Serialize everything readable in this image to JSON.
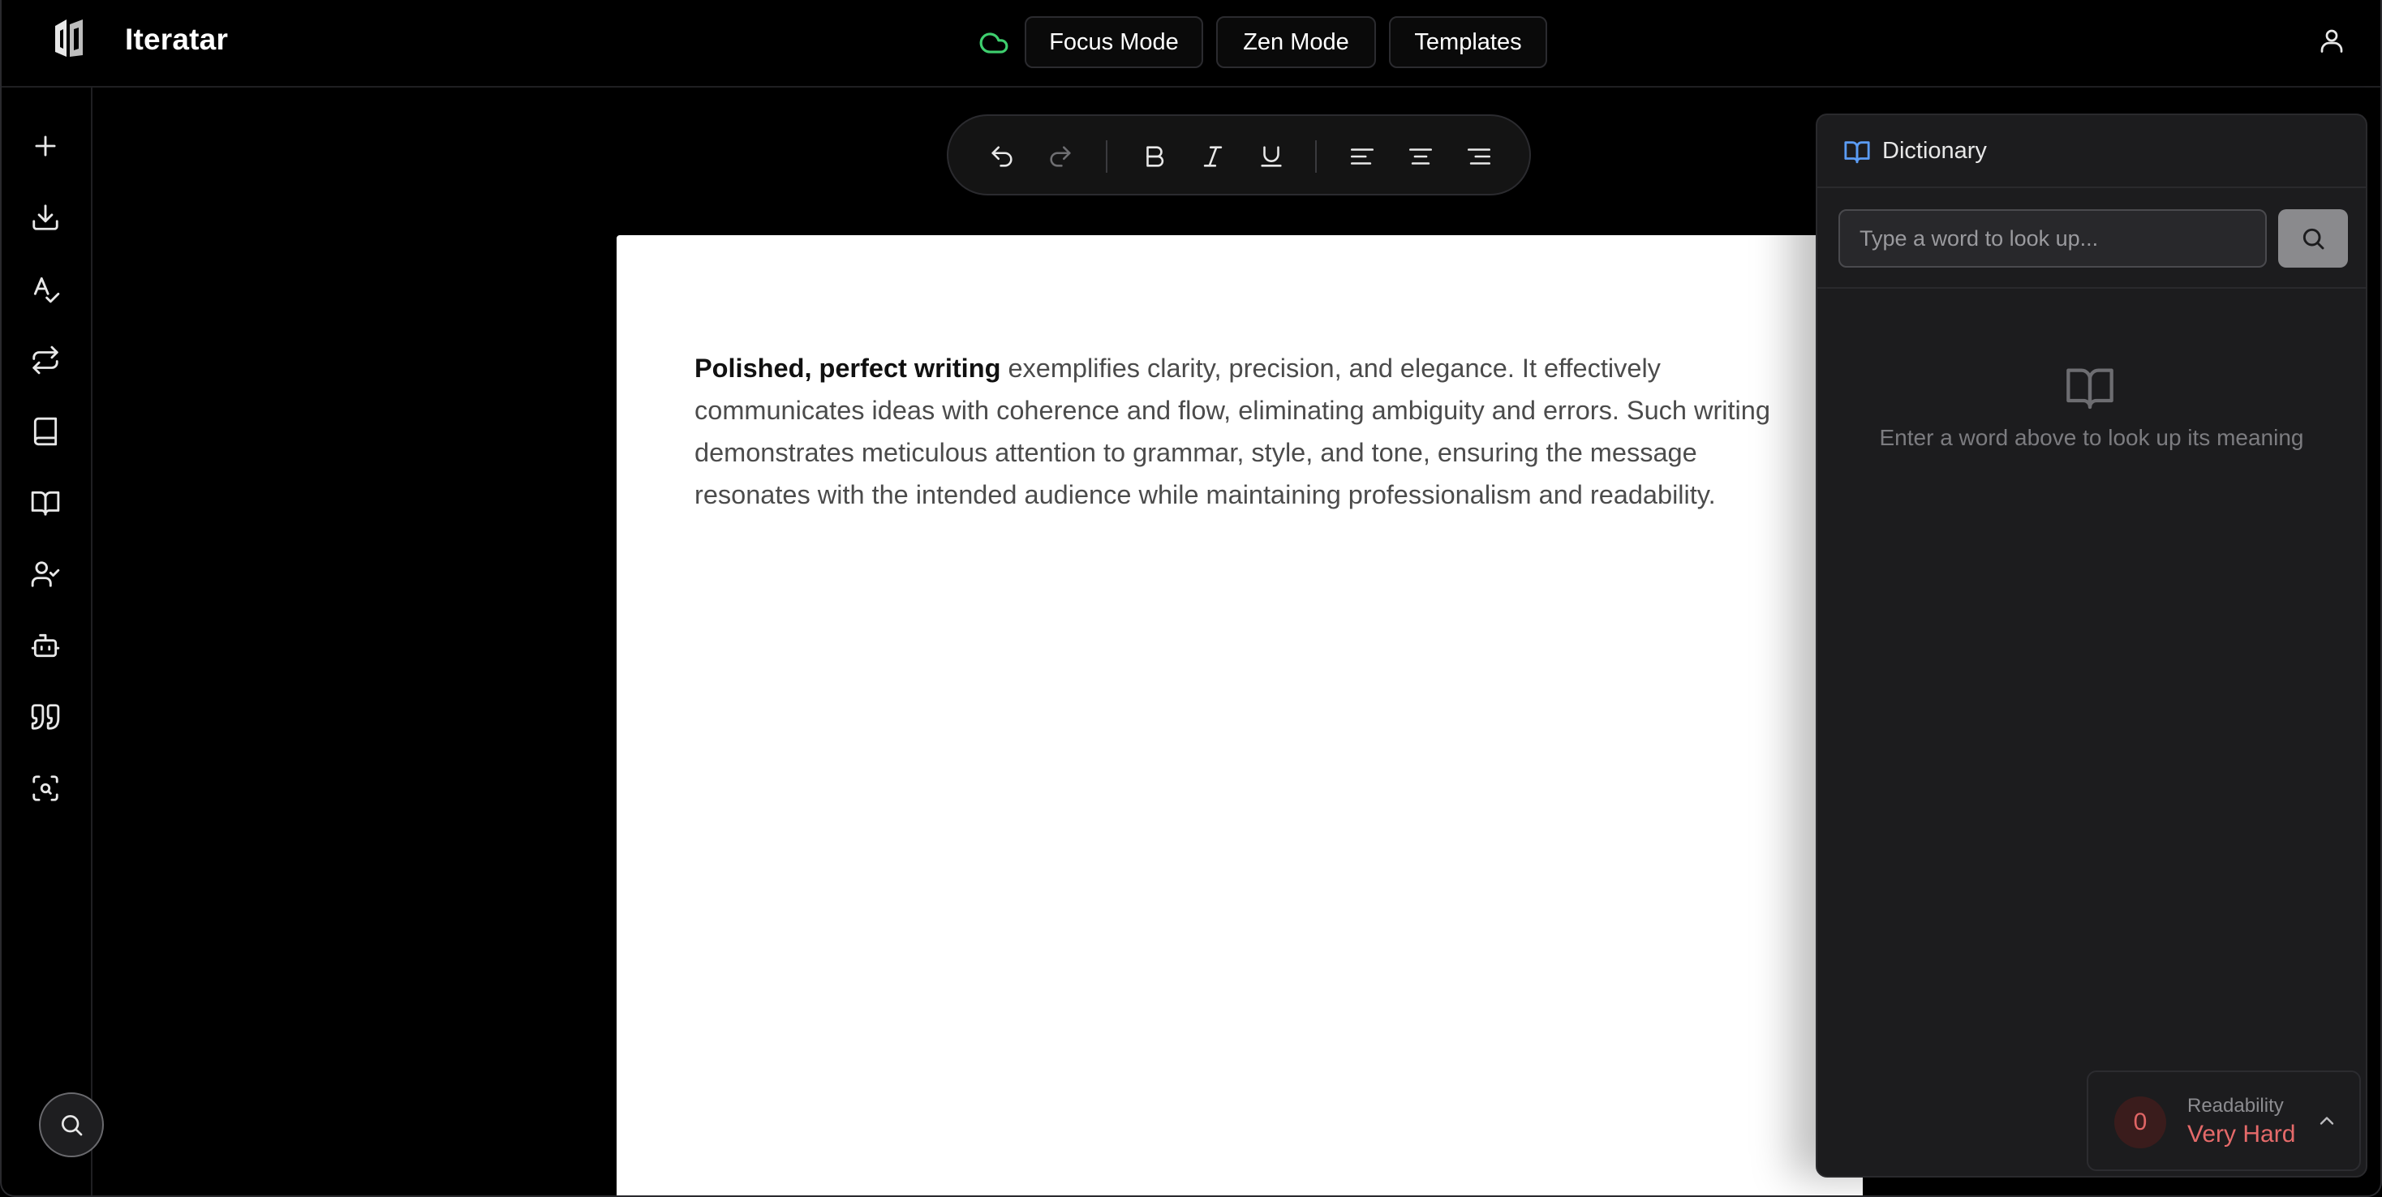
{
  "app": {
    "name": "Iteratar"
  },
  "topbar": {
    "focus_mode_label": "Focus Mode",
    "zen_mode_label": "Zen Mode",
    "templates_label": "Templates",
    "sync_status_color": "#3ecf6e"
  },
  "sidebar": {
    "items": [
      {
        "icon": "plus-icon"
      },
      {
        "icon": "download-icon"
      },
      {
        "icon": "spell-check-icon"
      },
      {
        "icon": "repeat-icon"
      },
      {
        "icon": "book-icon"
      },
      {
        "icon": "book-open-icon"
      },
      {
        "icon": "user-check-icon"
      },
      {
        "icon": "bot-icon"
      },
      {
        "icon": "quote-icon"
      },
      {
        "icon": "scan-search-icon"
      }
    ]
  },
  "toolbar": {
    "buttons": [
      "undo-icon",
      "redo-icon",
      "bold-icon",
      "italic-icon",
      "underline-icon",
      "align-left-icon",
      "align-center-icon",
      "align-right-icon"
    ]
  },
  "document": {
    "lead": "Polished, perfect writing",
    "body": " exemplifies clarity, precision, and elegance. It effectively communicates ideas with coherence and flow, eliminating ambiguity and errors. Such writing demonstrates meticulous attention to grammar, style, and tone, ensuring the message resonates with the intended audience while maintaining professionalism and readability."
  },
  "dictionary": {
    "title": "Dictionary",
    "search_placeholder": "Type a word to look up...",
    "search_value": "",
    "empty_message": "Enter a word above to look up its meaning"
  },
  "readability": {
    "score": "0",
    "label": "Readability",
    "level": "Very Hard",
    "level_color": "#e56a6a"
  }
}
